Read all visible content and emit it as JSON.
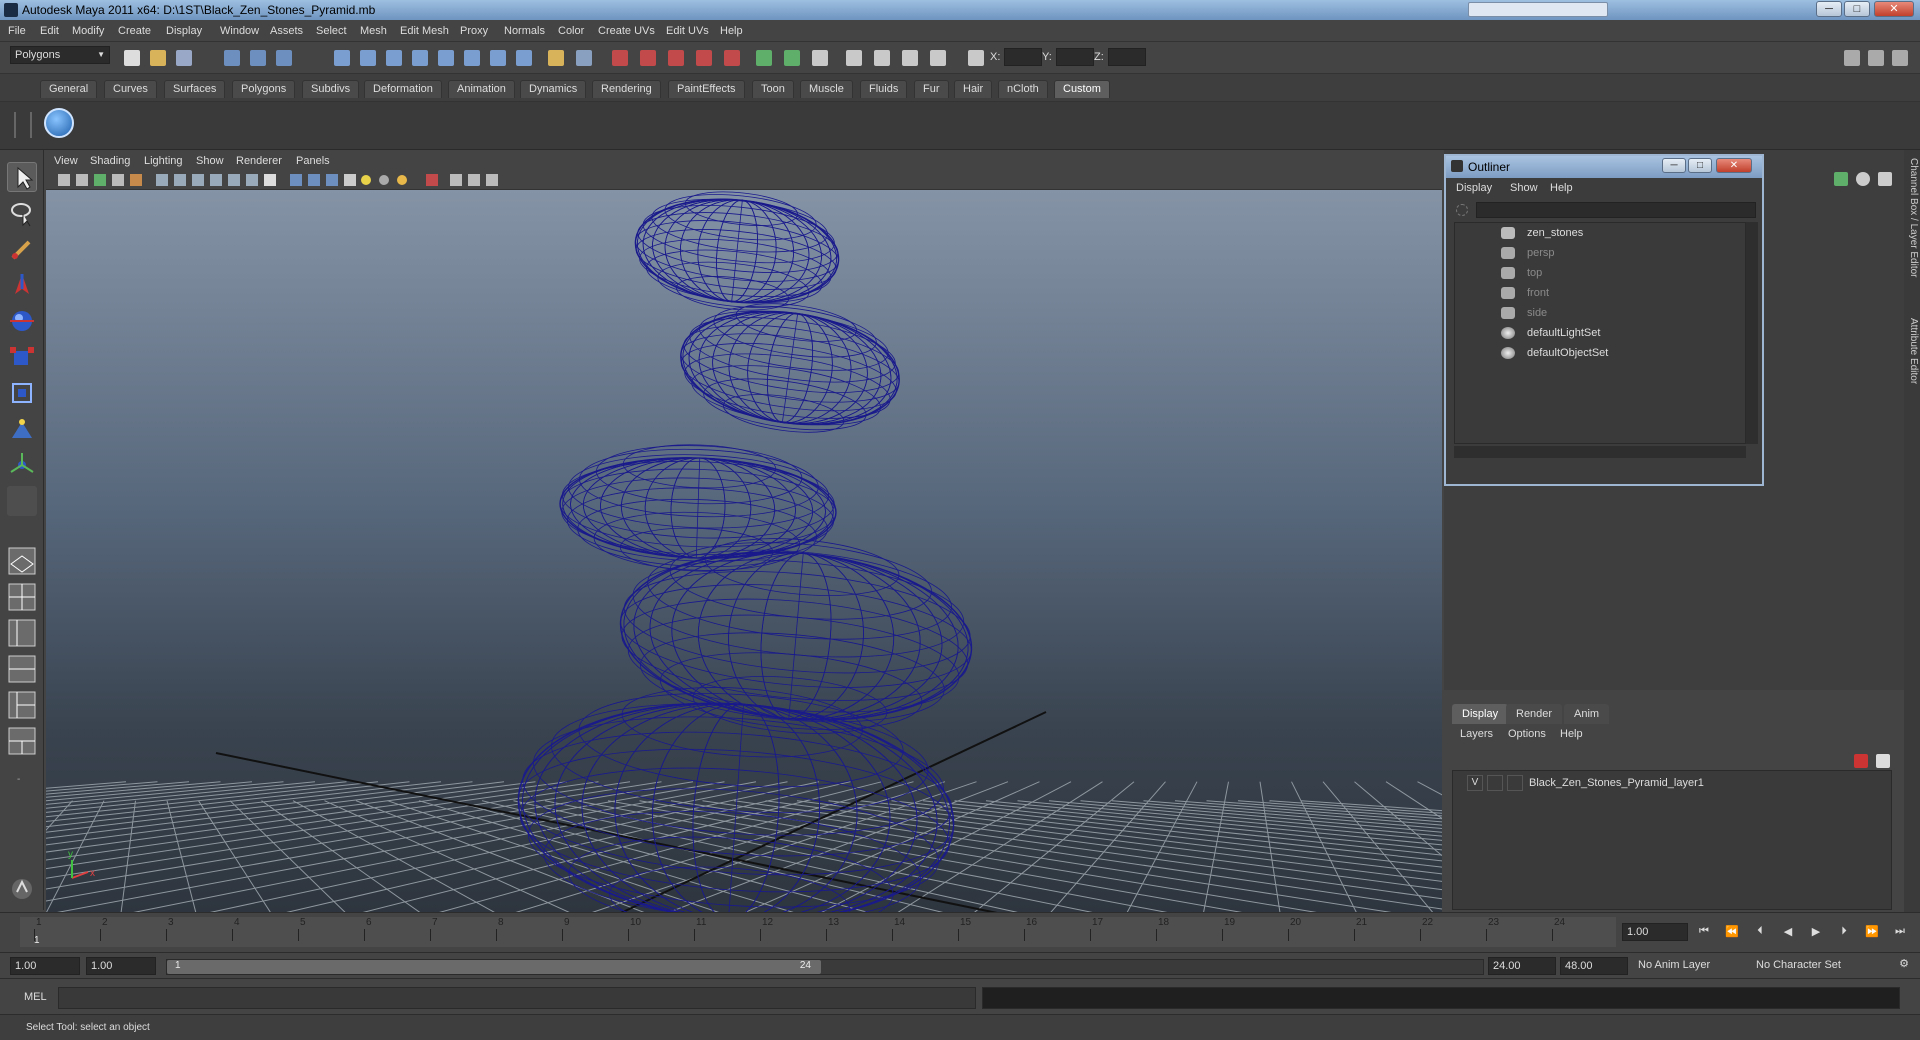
{
  "window": {
    "title": "Autodesk Maya 2011 x64: D:\\1ST\\Black_Zen_Stones_Pyramid.mb",
    "minimize": "─",
    "maximize": "□",
    "close": "✕"
  },
  "menubar": {
    "items": [
      "File",
      "Edit",
      "Modify",
      "Create",
      "Display",
      "Window",
      "Assets",
      "Select",
      "Mesh",
      "Edit Mesh",
      "Proxy",
      "Normals",
      "Color",
      "Create UVs",
      "Edit UVs",
      "Help"
    ]
  },
  "toolbar": {
    "mode": "Polygons",
    "x_label": "X:",
    "y_label": "Y:",
    "z_label": "Z:"
  },
  "shelf": {
    "tabs": [
      "General",
      "Curves",
      "Surfaces",
      "Polygons",
      "Subdivs",
      "Deformation",
      "Animation",
      "Dynamics",
      "Rendering",
      "PaintEffects",
      "Toon",
      "Muscle",
      "Fluids",
      "Fur",
      "Hair",
      "nCloth",
      "Custom"
    ],
    "active_tab": "Custom"
  },
  "viewport": {
    "menu": [
      "View",
      "Shading",
      "Lighting",
      "Show",
      "Renderer",
      "Panels"
    ],
    "wire_color": "#1a1a8c",
    "axis": {
      "x": "x",
      "y": "y"
    }
  },
  "outliner": {
    "title": "Outliner",
    "menu": [
      "Display",
      "Show",
      "Help"
    ],
    "items": [
      {
        "label": "zen_stones",
        "dim": false,
        "icon": "group-icon"
      },
      {
        "label": "persp",
        "dim": true,
        "icon": "camera-icon"
      },
      {
        "label": "top",
        "dim": true,
        "icon": "camera-icon"
      },
      {
        "label": "front",
        "dim": true,
        "icon": "camera-icon"
      },
      {
        "label": "side",
        "dim": true,
        "icon": "camera-icon"
      },
      {
        "label": "defaultLightSet",
        "dim": false,
        "icon": "set-icon"
      },
      {
        "label": "defaultObjectSet",
        "dim": false,
        "icon": "set-icon"
      }
    ]
  },
  "layer_editor": {
    "tabs": [
      "Display",
      "Render",
      "Anim"
    ],
    "active_tab": "Display",
    "menu": [
      "Layers",
      "Options",
      "Help"
    ],
    "layer": {
      "visible": "V",
      "name": "Black_Zen_Stones_Pyramid_layer1"
    }
  },
  "side_tabs": [
    "Channel Box / Layer Editor",
    "Attribute Editor"
  ],
  "timeslider": {
    "frames": [
      "1",
      "2",
      "3",
      "4",
      "5",
      "6",
      "7",
      "8",
      "9",
      "10",
      "11",
      "12",
      "13",
      "14",
      "15",
      "16",
      "17",
      "18",
      "19",
      "20",
      "21",
      "22",
      "23",
      "24"
    ],
    "current_frame": "1",
    "current_field": "1.00"
  },
  "range": {
    "start": "1.00",
    "anim_start": "1.00",
    "range_start": "1",
    "range_end": "24",
    "anim_end": "24.00",
    "end": "48.00",
    "anim_layer": "No Anim Layer",
    "character_set": "No Character Set"
  },
  "cmdline": {
    "label": "MEL"
  },
  "helpline": {
    "text": "Select Tool: select an object"
  }
}
